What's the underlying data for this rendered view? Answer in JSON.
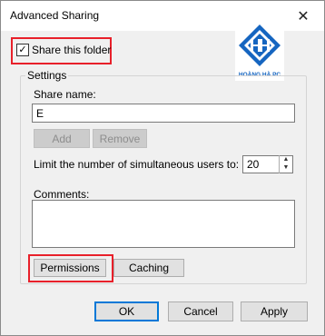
{
  "window": {
    "title": "Advanced Sharing",
    "close_glyph": "✕"
  },
  "share_checkbox": {
    "label": "Share this folder",
    "checked": true,
    "check_glyph": "✓"
  },
  "logo": {
    "text": "HOÀNG HÀ PC",
    "monogram": "HH"
  },
  "settings": {
    "legend": "Settings",
    "share_name_label": "Share name:",
    "share_name_value": "E",
    "add_label": "Add",
    "remove_label": "Remove",
    "limit_label": "Limit the number of simultaneous users to:",
    "limit_value": "20",
    "comments_label": "Comments:",
    "comments_value": "",
    "permissions_label": "Permissions",
    "caching_label": "Caching"
  },
  "footer": {
    "ok_label": "OK",
    "cancel_label": "Cancel",
    "apply_label": "Apply"
  },
  "colors": {
    "highlight_frame": "#e8202a",
    "focus_blue": "#0078d7",
    "logo_blue": "#1565c0"
  }
}
